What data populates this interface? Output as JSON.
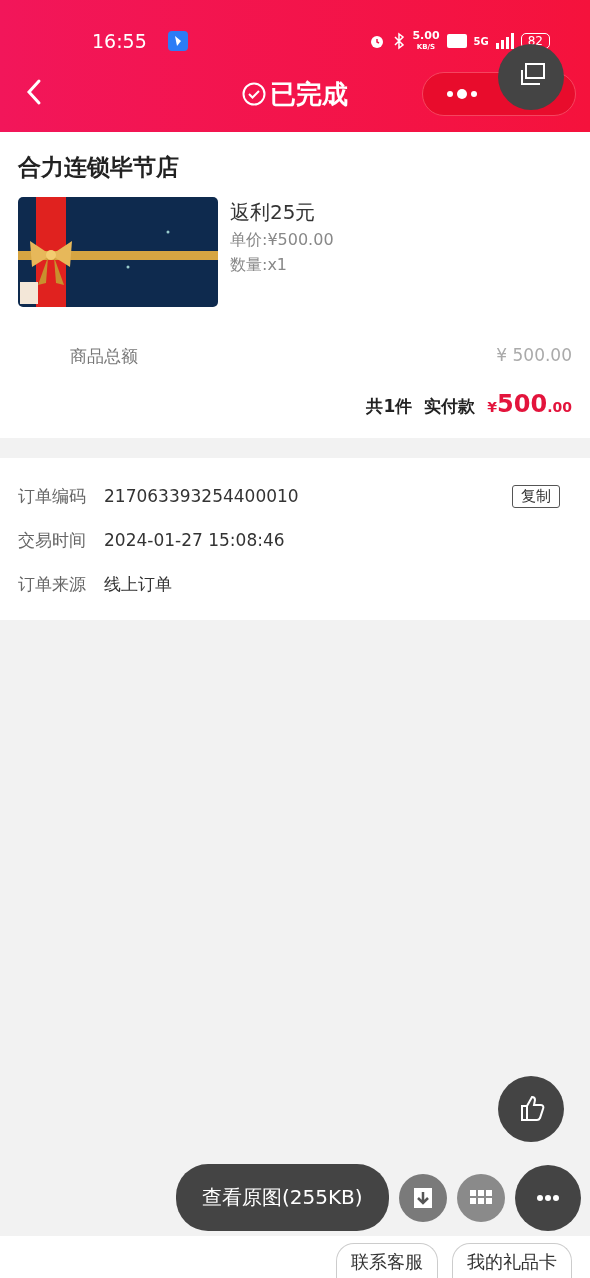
{
  "status_bar": {
    "time": "16:55",
    "speed": "5.00",
    "speed_unit": "KB/S",
    "network": "5G",
    "battery": "82"
  },
  "header": {
    "title": "已完成"
  },
  "store": {
    "name": "合力连锁毕节店",
    "item": {
      "kind": "picture",
      "title": "返利25元",
      "price_label": "单价:",
      "price": "¥500.00",
      "qty_label": "数量:",
      "qty": "x1"
    },
    "subtotal_label": "商品总额",
    "subtotal": "¥ 500.00",
    "count": "共1件",
    "paid_label": "实付款",
    "paid_currency": "¥",
    "paid_int": "500",
    "paid_dec": ".00"
  },
  "info": [
    {
      "label": "订单编码",
      "value": "217063393254400010",
      "action": "复制"
    },
    {
      "label": "交易时间",
      "value": "2024-01-27 15:08:46"
    },
    {
      "label": "订单来源",
      "value": "线上订单"
    }
  ],
  "overlay": {
    "view_original": "查看原图(255KB)"
  },
  "bottom_buttons": [
    "联系客服",
    "我的礼品卡"
  ]
}
